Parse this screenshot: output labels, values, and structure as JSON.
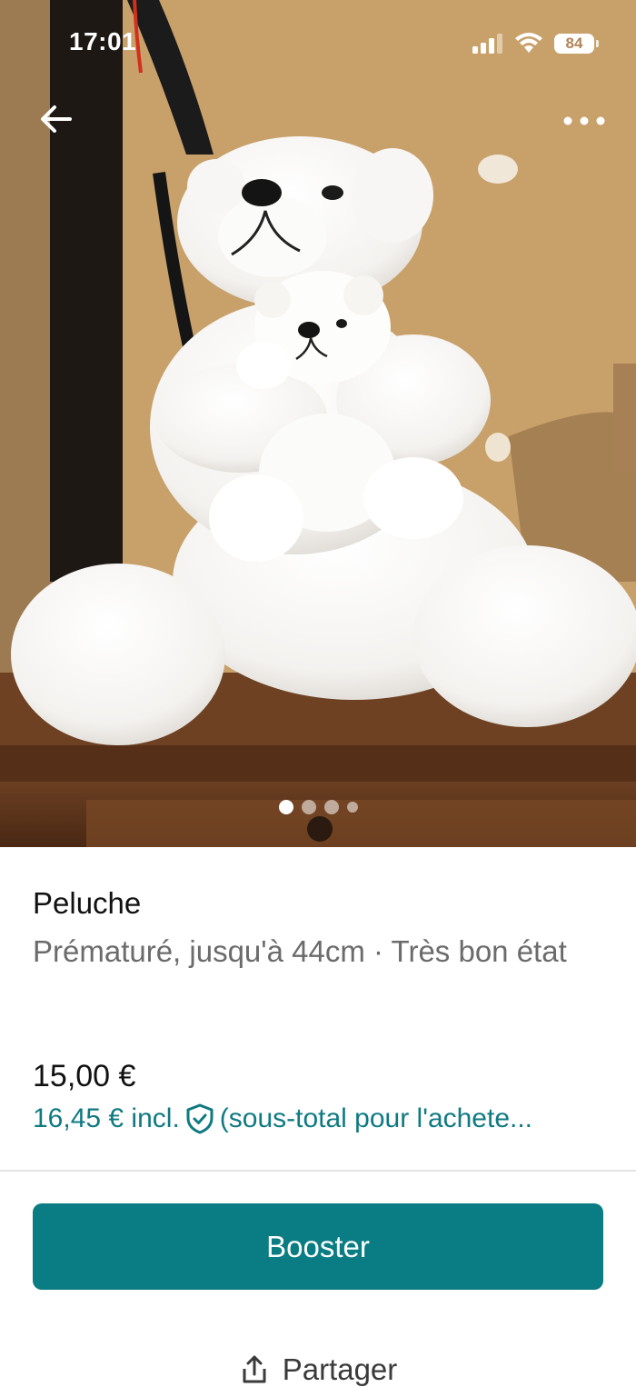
{
  "status_bar": {
    "time": "17:01",
    "battery": "84"
  },
  "gallery": {
    "image_count": 4,
    "active_index": 0
  },
  "item": {
    "title": "Peluche",
    "subtitle": "Prématuré, jusqu'à 44cm · Très bon état",
    "price": "15,00 €",
    "buyer_price": "16,45 € incl.",
    "buyer_price_note": "(sous-total pour l'achete..."
  },
  "actions": {
    "booster_label": "Booster",
    "share_label": "Partager"
  },
  "colors": {
    "accent": "#0a7c83",
    "link": "#0f7a82"
  }
}
